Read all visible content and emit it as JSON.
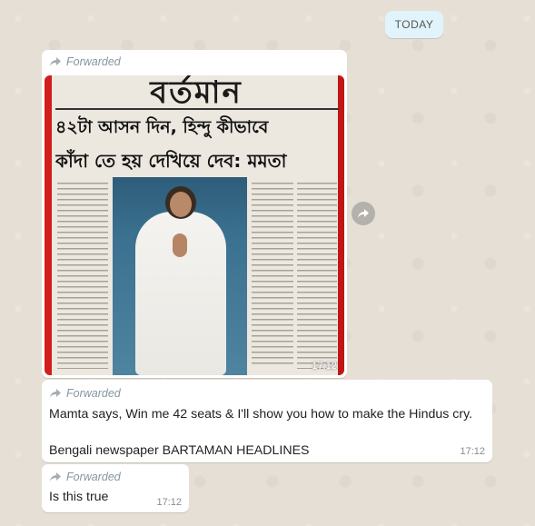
{
  "date_chip": "TODAY",
  "messages": [
    {
      "forwarded_label": "Forwarded",
      "time": "17:12",
      "image_alt": "Bartaman newspaper front page with Mamata Banerjee photo"
    },
    {
      "forwarded_label": "Forwarded",
      "text": "Mamta says, Win me 42 seats & I'll show you how to make the Hindus cry.\n\nBengali newspaper BARTAMAN HEADLINES",
      "time": "17:12"
    },
    {
      "forwarded_label": "Forwarded",
      "text": "Is this true",
      "time": "17:12"
    }
  ],
  "newspaper": {
    "masthead": "বর্তমান",
    "headline_1": "৪২টা আসন দিন, হিন্দু কীভাবে",
    "headline_2": "কাঁদা তে হয় দেখিয়ে দেব: মমতা"
  },
  "colors": {
    "chat_background": "#e6dfd6",
    "bubble": "#ffffff",
    "date_chip": "#e1f3fb",
    "forwarded_text": "#8696a0"
  },
  "icons": {
    "forward": "forward-arrow-icon",
    "share": "share-forward-icon"
  }
}
